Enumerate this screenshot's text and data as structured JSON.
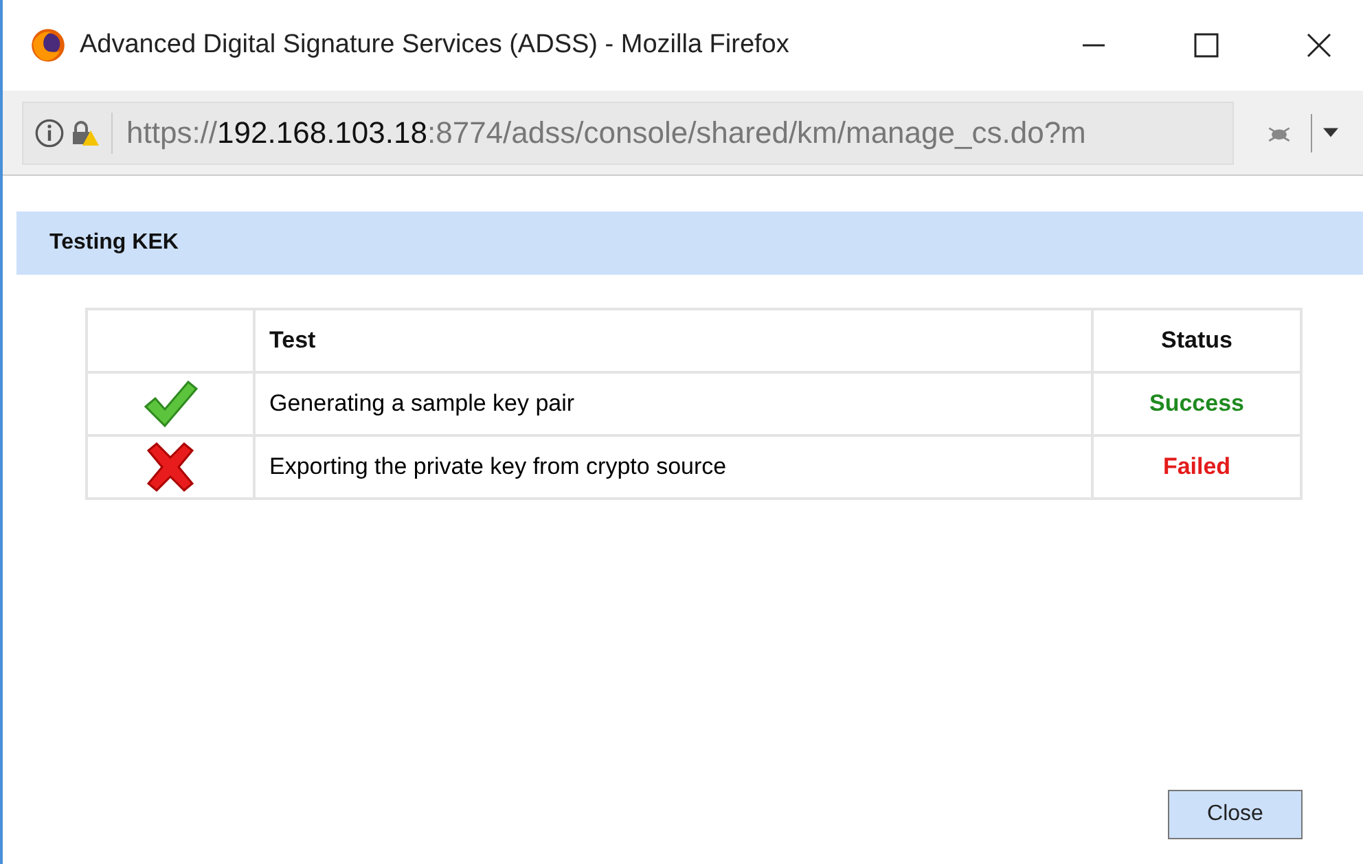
{
  "window": {
    "title": "Advanced Digital Signature Services (ADSS) - Mozilla Firefox"
  },
  "address_bar": {
    "url_parts": [
      {
        "text": "https://",
        "kind": "dim"
      },
      {
        "text": "192.168.103.18",
        "kind": "host"
      },
      {
        "text": ":8774/adss/console/shared/km/manage_cs.do?m",
        "kind": "dim"
      }
    ]
  },
  "panel": {
    "title": "Testing KEK"
  },
  "table": {
    "columns": [
      "Test",
      "Status"
    ],
    "rows": [
      {
        "kind": "success",
        "test": "Generating a sample key pair",
        "status": "Success"
      },
      {
        "kind": "failed",
        "test": "Exporting the private key from crypto source",
        "status": "Failed"
      }
    ]
  },
  "buttons": [
    "Close"
  ]
}
